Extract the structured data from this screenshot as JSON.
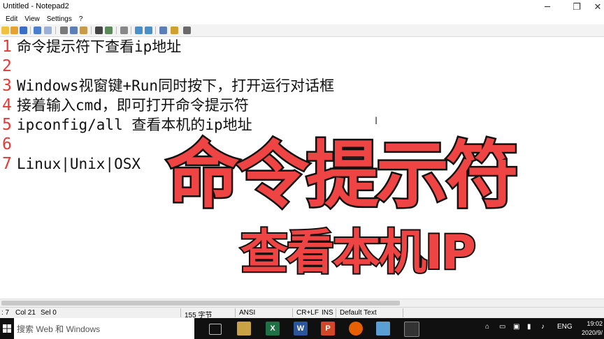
{
  "window": {
    "title": "Untitled - Notepad2",
    "minimize_glyph": "─",
    "maximize_glyph": "❐",
    "close_glyph": "✕"
  },
  "menu": [
    "Edit",
    "View",
    "Settings",
    "?"
  ],
  "toolbar_icons": [
    "new-file-icon",
    "open-file-icon",
    "save-icon",
    "undo-icon",
    "redo-icon",
    "cut-icon",
    "copy-icon",
    "paste-icon",
    "find-icon",
    "replace-icon",
    "word-wrap-icon",
    "zoom-in-icon",
    "zoom-out-icon",
    "scheme-icon",
    "customize-icon"
  ],
  "editor": {
    "lines": [
      {
        "num": "1",
        "text": "命令提示符下查看ip地址"
      },
      {
        "num": "2",
        "text": ""
      },
      {
        "num": "3",
        "text": "Windows视窗键+Run同时按下，打开运行对话框"
      },
      {
        "num": "4",
        "text": "接着输入cmd，即可打开命令提示符"
      },
      {
        "num": "5",
        "text": "ipconfig/all 查看本机的ip地址"
      },
      {
        "num": "6",
        "text": ""
      },
      {
        "num": "7",
        "text": "Linux|Unix|OSX"
      }
    ],
    "caret_glyph": "I"
  },
  "overlay": {
    "main": "命令提示符",
    "sub": "查看本机IP",
    "fill_color": "#ef4444",
    "stroke_color": "#111111"
  },
  "statusbar": {
    "ln": ": 7",
    "col": "Col 21",
    "sel": "Sel 0",
    "size": "155 字节",
    "encoding": "ANSI",
    "eol": "CR+LF",
    "mode": "INS",
    "scheme": "Default Text"
  },
  "taskbar": {
    "search_placeholder": "搜索 Web 和 Windows",
    "excel_letter": "X",
    "word_letter": "W",
    "ppt_letter": "P",
    "language": "ENG",
    "time": "19:02",
    "date": "2020/9/"
  }
}
